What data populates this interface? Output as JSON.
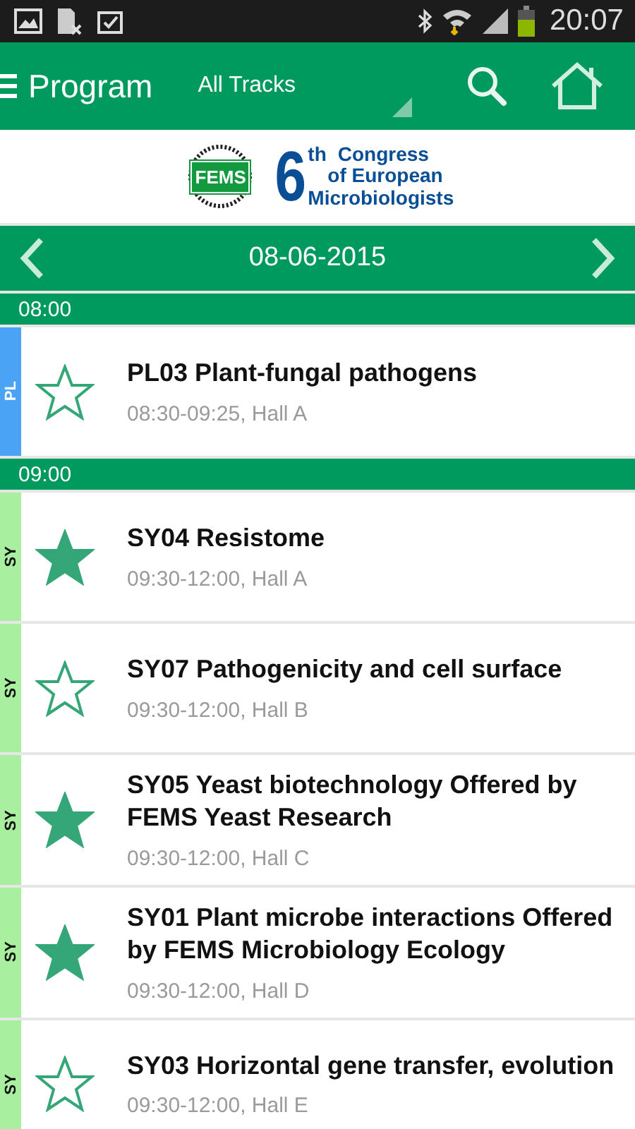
{
  "status_bar": {
    "time": "20:07"
  },
  "toolbar": {
    "title": "Program",
    "track_filter": "All Tracks"
  },
  "banner": {
    "badge": "FEMS",
    "number": "6",
    "suffix": "th",
    "line_1": "Congress",
    "line_2": "of European",
    "line_3": "Microbiologists"
  },
  "date_bar": {
    "date": "08-06-2015"
  },
  "sections": [
    {
      "time": "08:00",
      "sessions": [
        {
          "track": "PL",
          "color": "#4aa3f5",
          "favorite": false,
          "title": "PL03 Plant-fungal pathogens",
          "details": "08:30-09:25, Hall A"
        }
      ]
    },
    {
      "time": "09:00",
      "sessions": [
        {
          "track": "SY",
          "color": "#a8f0a0",
          "favorite": true,
          "title": "SY04 Resistome",
          "details": "09:30-12:00, Hall A"
        },
        {
          "track": "SY",
          "color": "#a8f0a0",
          "favorite": false,
          "title": "SY07 Pathogenicity and cell surface",
          "details": "09:30-12:00, Hall B"
        },
        {
          "track": "SY",
          "color": "#a8f0a0",
          "favorite": true,
          "title": "SY05 Yeast biotechnology Offered by FEMS Yeast Research",
          "details": "09:30-12:00, Hall C"
        },
        {
          "track": "SY",
          "color": "#a8f0a0",
          "favorite": true,
          "title": "SY01 Plant microbe interactions Offered by FEMS Microbiology Ecology",
          "details": "09:30-12:00, Hall D"
        },
        {
          "track": "SY",
          "color": "#a8f0a0",
          "favorite": false,
          "title": "SY03 Horizontal gene transfer, evolution",
          "details": "09:30-12:00, Hall E"
        }
      ]
    }
  ]
}
